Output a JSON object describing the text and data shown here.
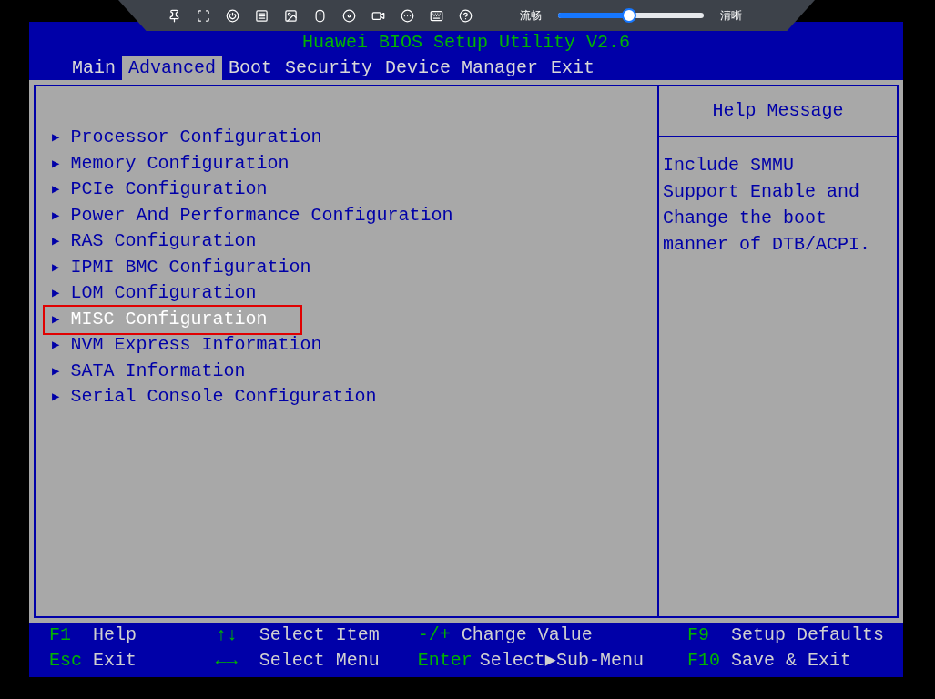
{
  "toolbar": {
    "quality_slider": {
      "left_label": "流畅",
      "right_label": "清晰",
      "level": 0.49
    }
  },
  "title": "Huawei BIOS Setup Utility V2.6",
  "tabs": [
    {
      "label": "Main",
      "selected": false
    },
    {
      "label": "Advanced",
      "selected": true
    },
    {
      "label": "Boot",
      "selected": false
    },
    {
      "label": "Security",
      "selected": false
    },
    {
      "label": "Device Manager",
      "selected": false
    },
    {
      "label": "Exit",
      "selected": false
    }
  ],
  "menu_items": [
    {
      "marker": "▶",
      "label": "Processor Configuration",
      "selected": false
    },
    {
      "marker": "▶",
      "label": "Memory Configuration",
      "selected": false
    },
    {
      "marker": "▶",
      "label": "PCIe Configuration",
      "selected": false
    },
    {
      "marker": "▶",
      "label": "Power And Performance Configuration",
      "selected": false
    },
    {
      "marker": "▶",
      "label": "RAS Configuration",
      "selected": false
    },
    {
      "marker": "▶",
      "label": "IPMI BMC Configuration",
      "selected": false
    },
    {
      "marker": "▶",
      "label": "LOM Configuration",
      "selected": false
    },
    {
      "marker": "▶",
      "label": "MISC Configuration",
      "selected": true
    },
    {
      "marker": "▶",
      "label": "NVM Express Information",
      "selected": false
    },
    {
      "marker": "▶",
      "label": "SATA Information",
      "selected": false
    },
    {
      "marker": "▶",
      "label": "Serial Console Configuration",
      "selected": false
    }
  ],
  "help": {
    "title": "Help Message",
    "text": "Include SMMU Support Enable and Change the boot manner of DTB/ACPI."
  },
  "footer": [
    {
      "key": "F1",
      "label": "Help"
    },
    {
      "key": "Esc",
      "label": "Exit"
    },
    {
      "key": "↑↓",
      "label": "Select Item"
    },
    {
      "key": "←→",
      "label": "Select Menu"
    },
    {
      "key": "-/+",
      "label": "Change Value"
    },
    {
      "key": "Enter",
      "label": "Select▶Sub-Menu"
    },
    {
      "key": "F9",
      "label": "Setup Defaults"
    },
    {
      "key": "F10",
      "label": "Save & Exit"
    }
  ]
}
